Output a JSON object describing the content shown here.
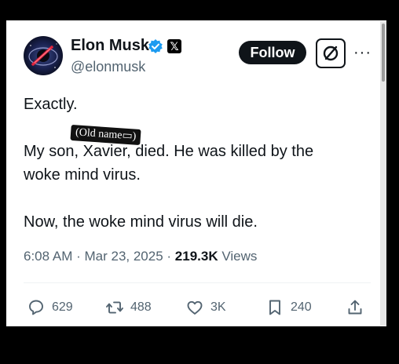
{
  "author": {
    "name": "Elon Musk",
    "handle": "@elonmusk",
    "x_badge": "𝕏"
  },
  "follow_label": "Follow",
  "more_label": "···",
  "sticker_text": "(Old name▭)",
  "text": {
    "line1": "Exactly.",
    "line2": "My son, Xavier, died. He was killed by the",
    "line3": "woke mind virus.",
    "line4": "Now, the woke mind virus will die."
  },
  "meta": {
    "time": "6:08 AM",
    "sep1": " · ",
    "date": "Mar 23, 2025",
    "sep2": " · ",
    "views_count": "219.3K",
    "views_label": " Views"
  },
  "actions": {
    "replies": "629",
    "reposts": "488",
    "likes": "3K",
    "bookmarks": "240"
  },
  "colors": {
    "verified": "#1d9bf0",
    "text": "#0f1419",
    "muted": "#536471"
  }
}
